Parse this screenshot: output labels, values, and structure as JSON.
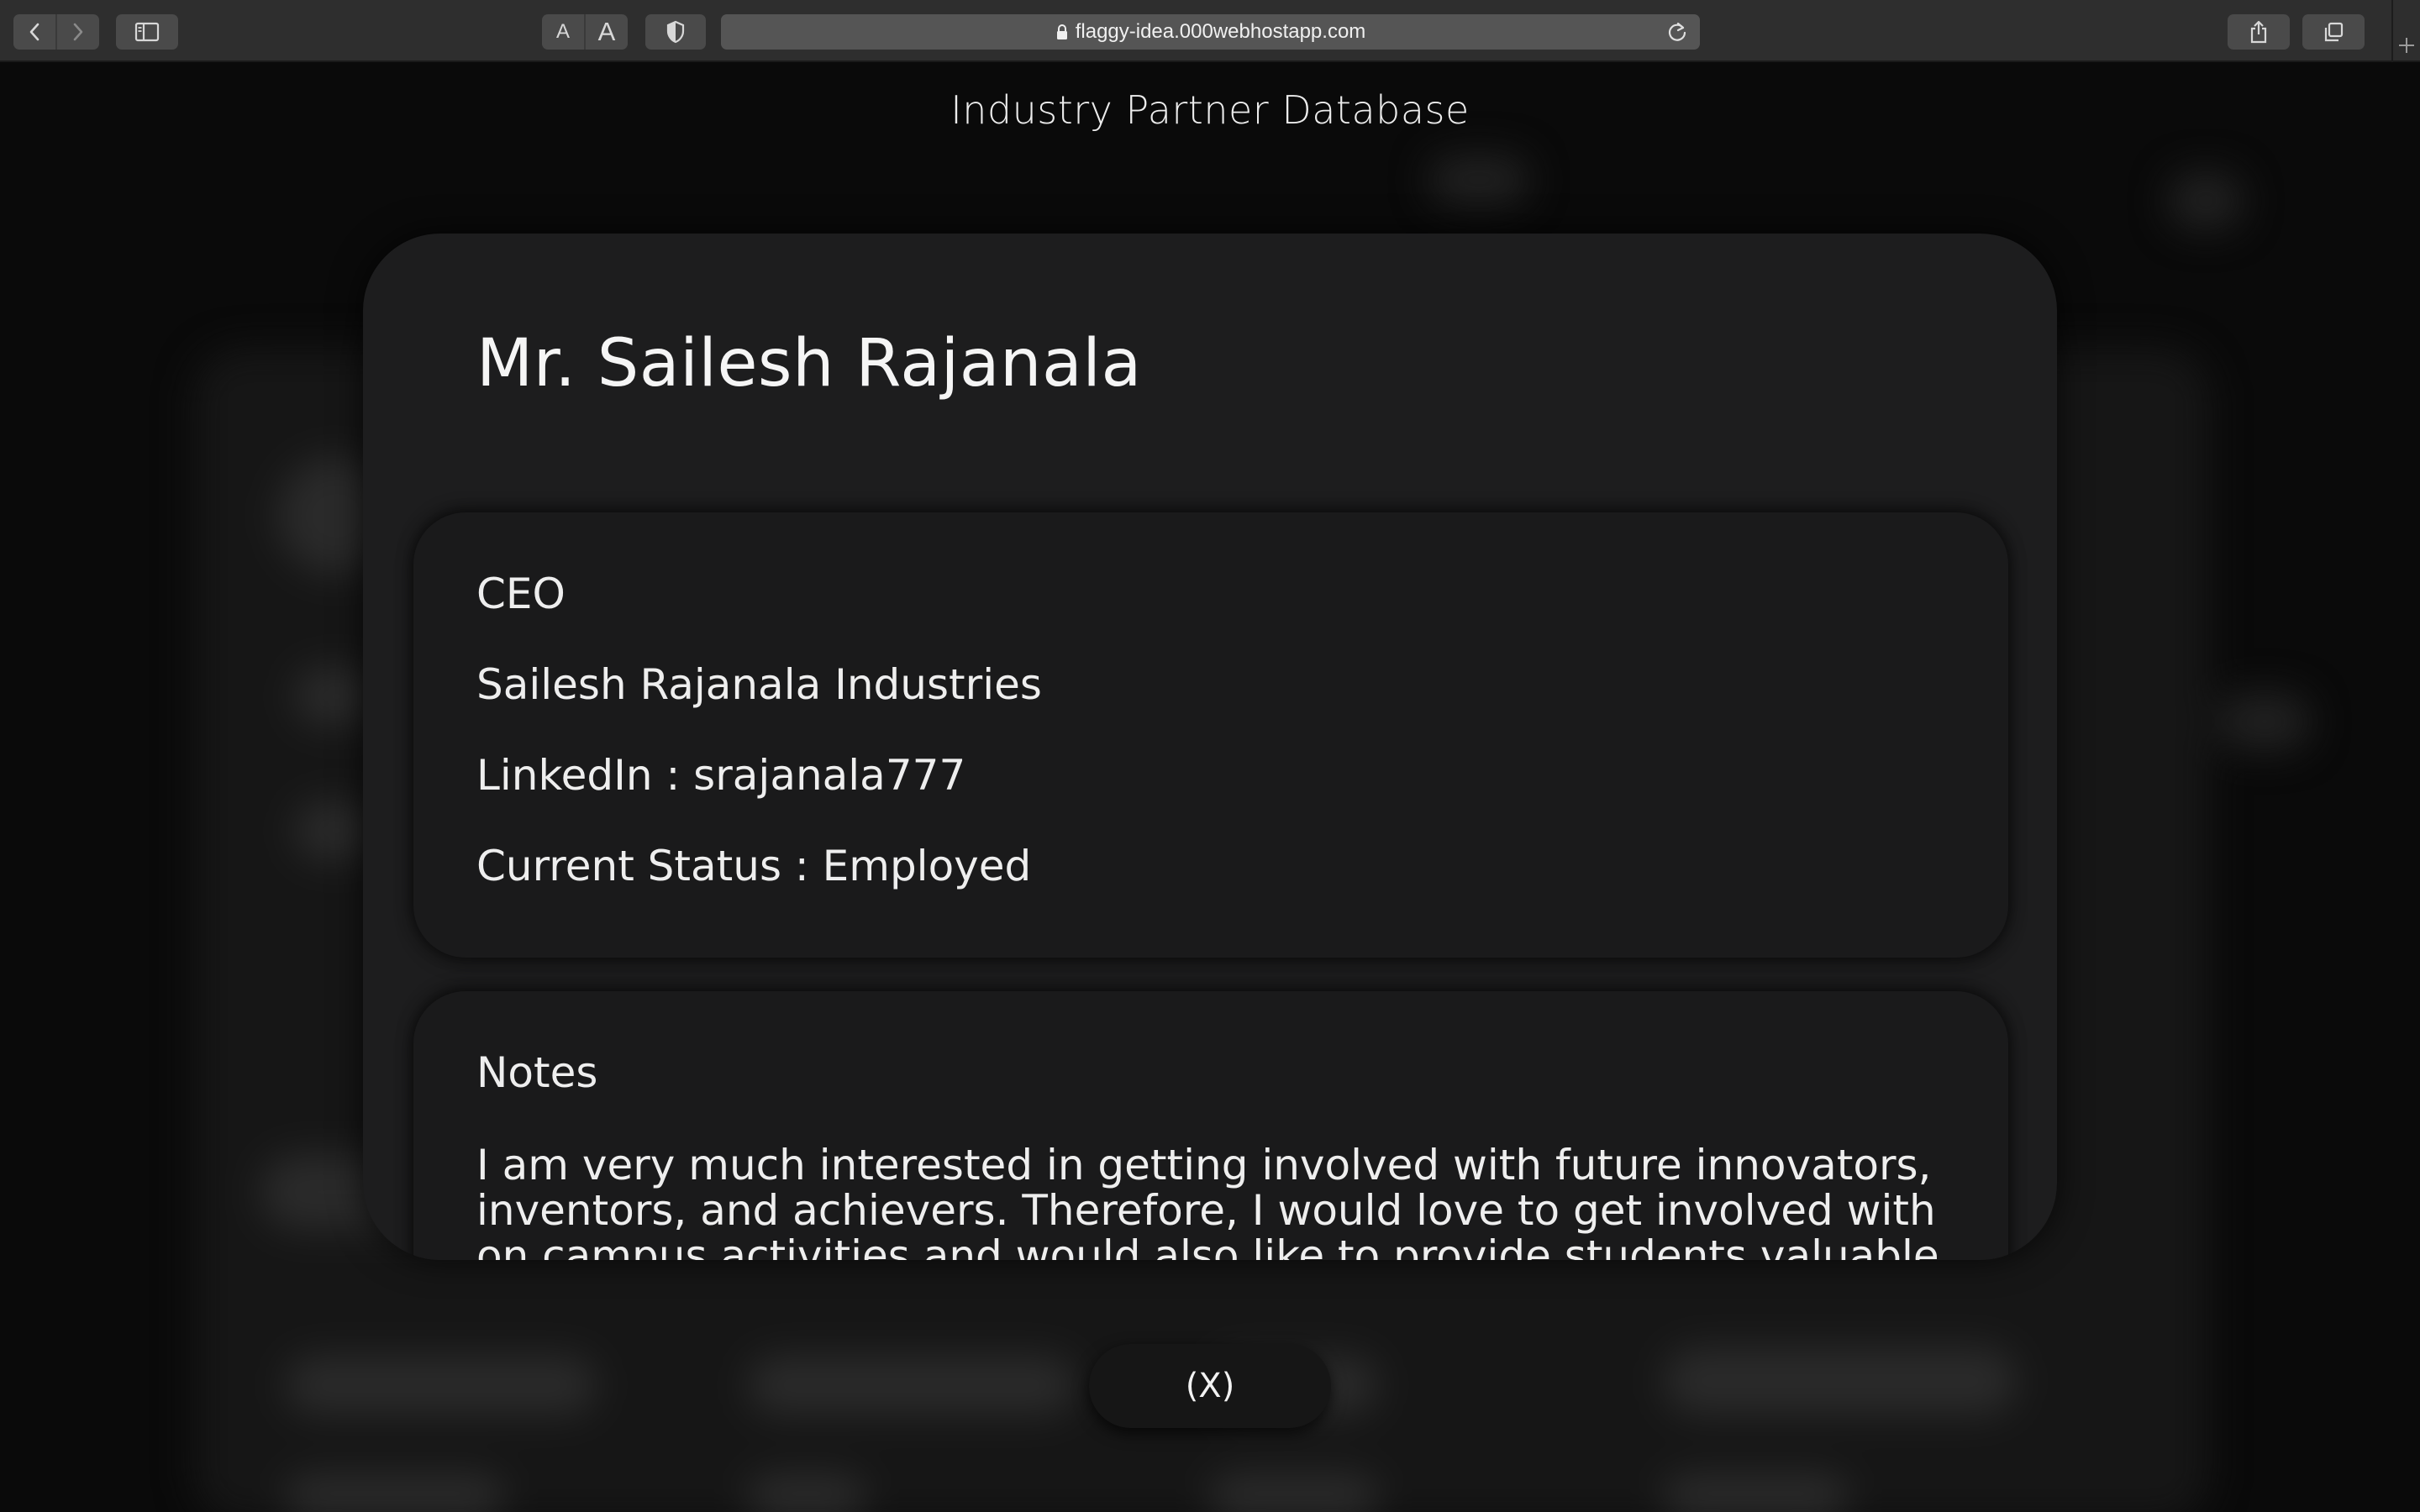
{
  "browser": {
    "url": "flaggy-idea.000webhostapp.com",
    "text_size_small": "A",
    "text_size_large": "A"
  },
  "page": {
    "heading": "Industry Partner Database"
  },
  "partner": {
    "name": "Mr. Sailesh Rajanala",
    "title": "CEO",
    "company": "Sailesh Rajanala Industries",
    "linkedin": "LinkedIn : srajanala777",
    "status": "Current Status : Employed",
    "notes_heading": "Notes",
    "notes": "I am very much interested in getting involved with future innovators, inventors, and achievers. Therefore, I would love to get involved with on campus activities and would also like to provide students valuable"
  },
  "close_button": {
    "label": "(X)"
  }
}
